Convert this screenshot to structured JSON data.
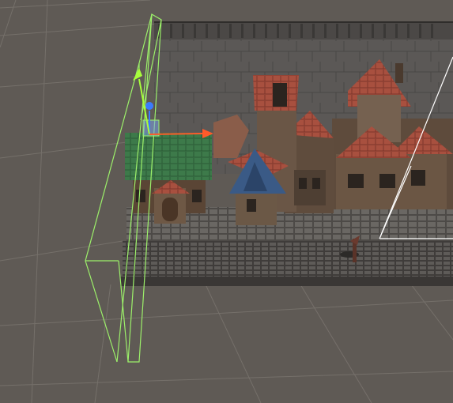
{
  "app": {
    "panel": "scene-view",
    "background_color": "#5f5a55",
    "grid_color": "#75706a"
  },
  "scene": {
    "objects": [
      {
        "name": "back-wall",
        "icon": "wall"
      },
      {
        "name": "cobblestone-street",
        "icon": "street"
      },
      {
        "name": "curb",
        "icon": "curb"
      },
      {
        "name": "building-green-roof",
        "roof_color": "#3d7a4a"
      },
      {
        "name": "building-blue-tower",
        "roof_color": "#3a5a86"
      },
      {
        "name": "building-red-tall",
        "roof_color": "#a8503f"
      },
      {
        "name": "building-row-right",
        "roof_color": "#a8503f"
      },
      {
        "name": "street-lamp",
        "icon": "lamp"
      }
    ],
    "selection": {
      "outline_color": "#9cf06a",
      "label": "selected-object-bounds"
    },
    "camera_frustum_color": "#ffffff"
  },
  "gizmo": {
    "tool": "move",
    "axes": [
      {
        "axis": "x",
        "color": "#ff5a2a",
        "icon": "arrow-right"
      },
      {
        "axis": "y",
        "color": "#a8ff3a",
        "icon": "arrow-up"
      },
      {
        "axis": "z",
        "color": "#3a7bff",
        "icon": "arrow-forward"
      }
    ]
  }
}
